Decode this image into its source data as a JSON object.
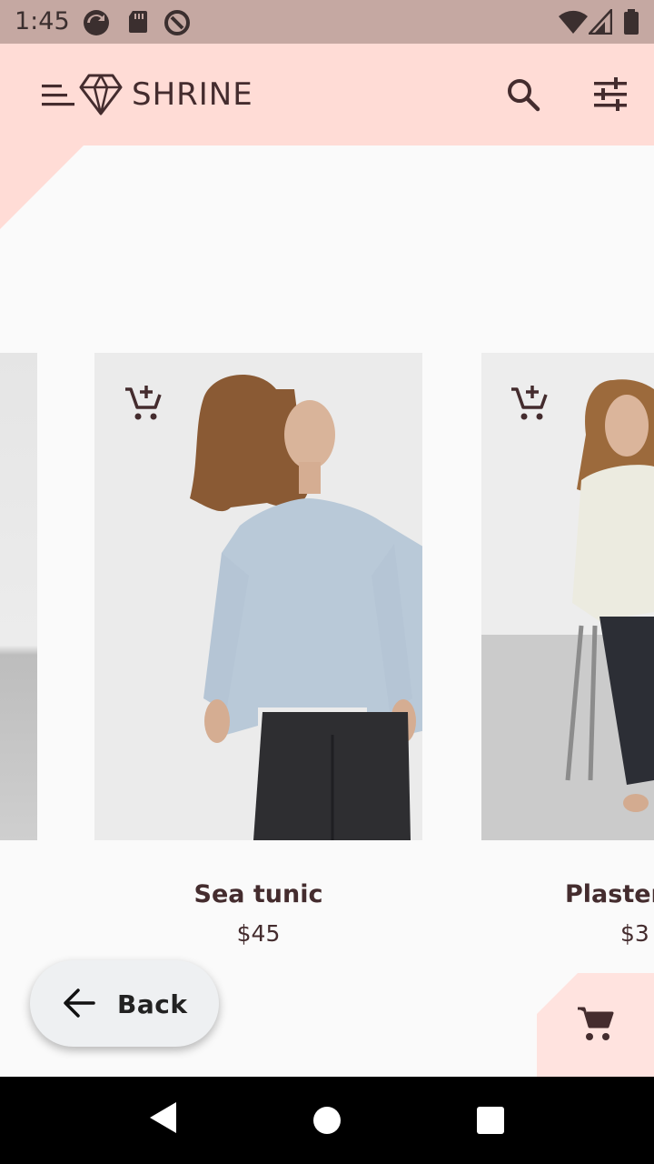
{
  "status_bar": {
    "time": "1:45"
  },
  "app": {
    "title": "SHRINE"
  },
  "products": [
    {
      "name": "Sea tunic",
      "price": "$45"
    },
    {
      "name": "Plaster",
      "price": "$3"
    }
  ],
  "back_button": {
    "label": "Back"
  },
  "colors": {
    "accent": "#FFDCD6",
    "status": "#C5A8A2",
    "text": "#442C2E",
    "surface": "#FAFAFA"
  }
}
